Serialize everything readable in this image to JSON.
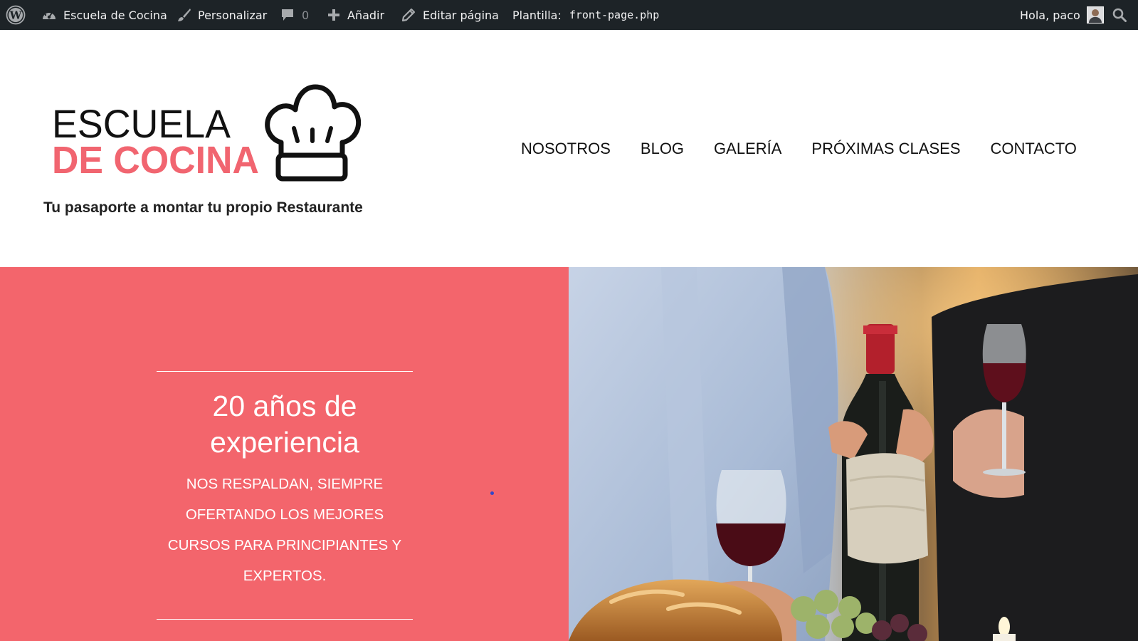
{
  "adminbar": {
    "site_name": "Escuela de Cocina",
    "customize": "Personalizar",
    "comments_count": "0",
    "add_new": "Añadir",
    "edit_page": "Editar página",
    "template_label": "Plantilla:",
    "template_file": "front-page.php",
    "greeting": "Hola, paco"
  },
  "header": {
    "logo_line1": "ESCUELA",
    "logo_line2": "DE COCINA",
    "tagline": "Tu pasaporte a montar tu propio Restaurante",
    "nav": [
      {
        "label": "NOSOTROS"
      },
      {
        "label": "BLOG"
      },
      {
        "label": "GALERÍA"
      },
      {
        "label": "PRÓXIMAS CLASES"
      },
      {
        "label": "CONTACTO"
      }
    ]
  },
  "hero": {
    "title": "20 años de experiencia",
    "subtitle": "NOS RESPALDAN, SIEMPRE OFERTANDO LOS MEJORES CURSOS PARA PRINCIPIANTES Y EXPERTOS."
  },
  "colors": {
    "adminbar_bg": "#1d2327",
    "brand_coral": "#f3656c",
    "logo_coral": "#f16570"
  },
  "icons": {
    "wordpress": "wordpress-logo-icon",
    "dashboard": "dashboard-icon",
    "customize": "paintbrush-icon",
    "comments": "comment-bubble-icon",
    "add": "plus-icon",
    "edit": "pencil-icon",
    "search": "search-icon"
  }
}
